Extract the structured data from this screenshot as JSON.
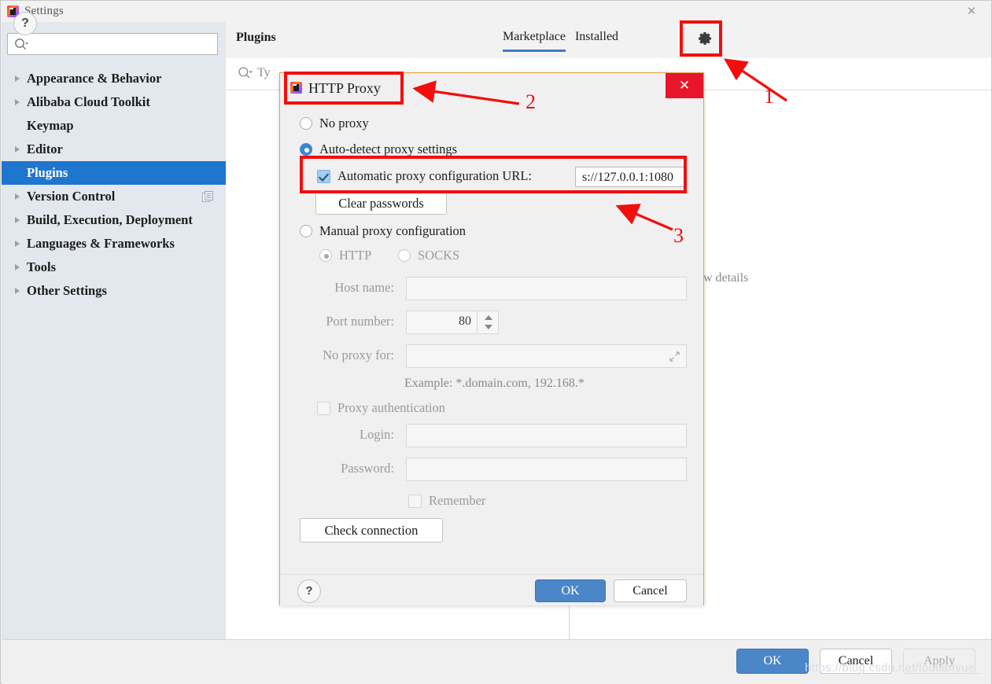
{
  "window": {
    "title": "Settings",
    "app_icon": "jetbrains-icon",
    "close_label": "✕"
  },
  "sidebar": {
    "search_placeholder": "",
    "search_icon": "search-icon",
    "items": [
      {
        "label": "Appearance & Behavior",
        "expandable": true,
        "selected": false,
        "badge": ""
      },
      {
        "label": "Alibaba Cloud Toolkit",
        "expandable": true,
        "selected": false,
        "badge": ""
      },
      {
        "label": "Keymap",
        "expandable": false,
        "selected": false,
        "badge": ""
      },
      {
        "label": "Editor",
        "expandable": true,
        "selected": false,
        "badge": ""
      },
      {
        "label": "Plugins",
        "expandable": false,
        "selected": true,
        "badge": ""
      },
      {
        "label": "Version Control",
        "expandable": true,
        "selected": false,
        "badge": "copy-icon"
      },
      {
        "label": "Build, Execution, Deployment",
        "expandable": true,
        "selected": false,
        "badge": ""
      },
      {
        "label": "Languages & Frameworks",
        "expandable": true,
        "selected": false,
        "badge": ""
      },
      {
        "label": "Tools",
        "expandable": true,
        "selected": false,
        "badge": ""
      },
      {
        "label": "Other Settings",
        "expandable": true,
        "selected": false,
        "badge": ""
      }
    ]
  },
  "content": {
    "page_title": "Plugins",
    "tabs": [
      {
        "label": "Marketplace",
        "active": true
      },
      {
        "label": "Installed",
        "active": false
      }
    ],
    "gear_icon": "gear-icon",
    "search_icon": "search-icon",
    "search_text": "Ty",
    "detail_placeholder": "ect plugin to preview details"
  },
  "settings_footer": {
    "help_label": "?",
    "ok_label": "OK",
    "cancel_label": "Cancel",
    "apply_label": "Apply"
  },
  "watermark": "https://blog.csdn.net/loutianyue_",
  "proxy_dialog": {
    "title": "HTTP Proxy",
    "icon": "jetbrains-icon",
    "close_label": "✕",
    "options": {
      "no_proxy": {
        "label": "No proxy",
        "checked": false
      },
      "auto_detect": {
        "label": "Auto-detect proxy settings",
        "checked": true
      },
      "auto_config_url": {
        "label": "Automatic proxy configuration URL:",
        "checked": true,
        "value": "s://127.0.0.1:1080"
      },
      "clear_passwords": {
        "label": "Clear passwords"
      },
      "manual": {
        "label": "Manual proxy configuration",
        "checked": false
      },
      "http": {
        "label": "HTTP",
        "checked": true
      },
      "socks": {
        "label": "SOCKS",
        "checked": false
      }
    },
    "fields": {
      "host_name": {
        "label": "Host name:",
        "value": ""
      },
      "port_number": {
        "label": "Port number:",
        "value": "80"
      },
      "no_proxy_for": {
        "label": "No proxy for:",
        "value": ""
      },
      "example_hint": "Example: *.domain.com, 192.168.*",
      "proxy_auth": {
        "label": "Proxy authentication",
        "checked": false
      },
      "login": {
        "label": "Login:",
        "value": ""
      },
      "password": {
        "label": "Password:",
        "value": ""
      },
      "remember": {
        "label": "Remember",
        "checked": false
      }
    },
    "check_connection_label": "Check connection",
    "footer": {
      "help_label": "?",
      "ok_label": "OK",
      "cancel_label": "Cancel"
    }
  },
  "annotations": {
    "markers": [
      {
        "number": "1"
      },
      {
        "number": "2"
      },
      {
        "number": "3"
      }
    ],
    "color": "#f40d0d"
  }
}
